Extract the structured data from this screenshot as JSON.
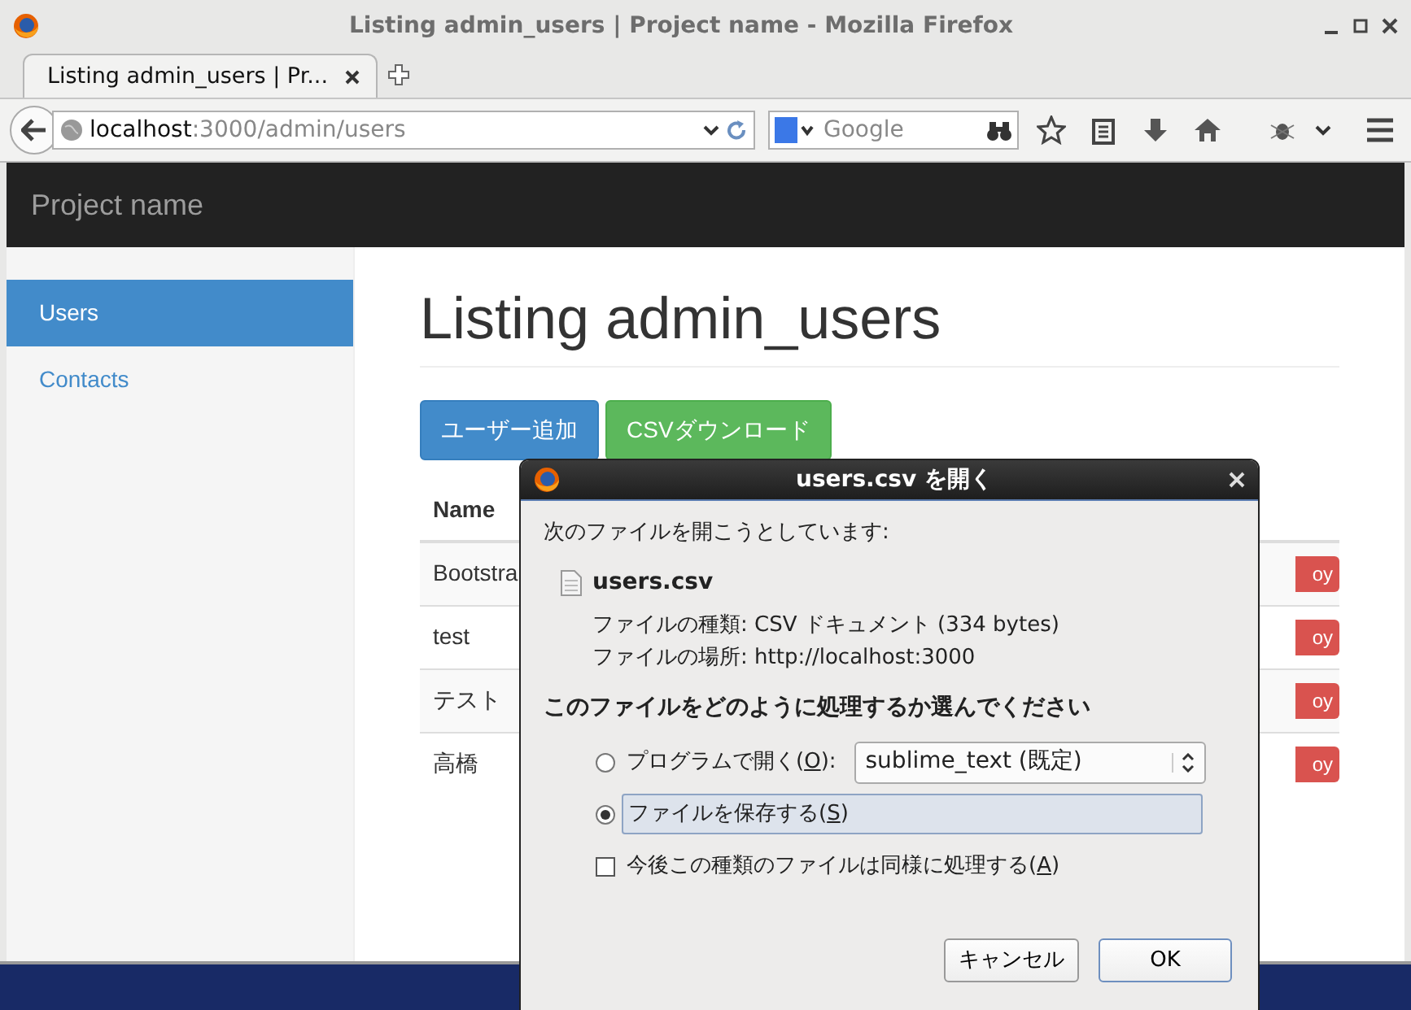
{
  "window": {
    "title": "Listing admin_users | Project name - Mozilla Firefox"
  },
  "tabs": [
    {
      "label": "Listing admin_users | Pr...",
      "selected": true
    }
  ],
  "address_bar": {
    "host": "localhost",
    "path": ":3000/admin/users"
  },
  "search": {
    "placeholder": "Google"
  },
  "page": {
    "brand": "Project name",
    "sidebar": [
      {
        "label": "Users",
        "selected": true
      },
      {
        "label": "Contacts",
        "selected": false
      }
    ],
    "heading": "Listing admin_users",
    "buttons": [
      {
        "label": "ユーザー追加",
        "kind": "primary"
      },
      {
        "label": "CSVダウンロード",
        "kind": "success"
      }
    ],
    "table": {
      "columns": [
        "Name"
      ],
      "rows": [
        {
          "name": "Bootstra",
          "action": "oy"
        },
        {
          "name": "test",
          "action": "oy"
        },
        {
          "name": "テスト",
          "action": "oy"
        },
        {
          "name": "高橋",
          "action": "oy"
        }
      ]
    }
  },
  "dialog": {
    "title": "users.csv を開く",
    "intro": "次のファイルを開こうとしています:",
    "file_name": "users.csv",
    "details": [
      {
        "label": "ファイルの種類:",
        "value": "CSV ドキュメント (334 bytes)"
      },
      {
        "label": "ファイルの場所:",
        "value": "http://localhost:3000"
      }
    ],
    "question": "このファイルをどのように処理するか選んでください",
    "options": [
      {
        "label": "プログラムで開く(",
        "mnemonic": "O",
        "suffix": "):",
        "selected": false,
        "program": "sublime_text (既定)"
      },
      {
        "label": "ファイルを保存する(",
        "mnemonic": "S",
        "suffix": ")",
        "selected": true
      }
    ],
    "remember": {
      "label": "今後この種類のファイルは同様に処理する(",
      "mnemonic": "A",
      "suffix": ")",
      "checked": false
    },
    "buttons": [
      {
        "label": "キャンセル",
        "default": false
      },
      {
        "label": "OK",
        "default": true
      }
    ]
  }
}
